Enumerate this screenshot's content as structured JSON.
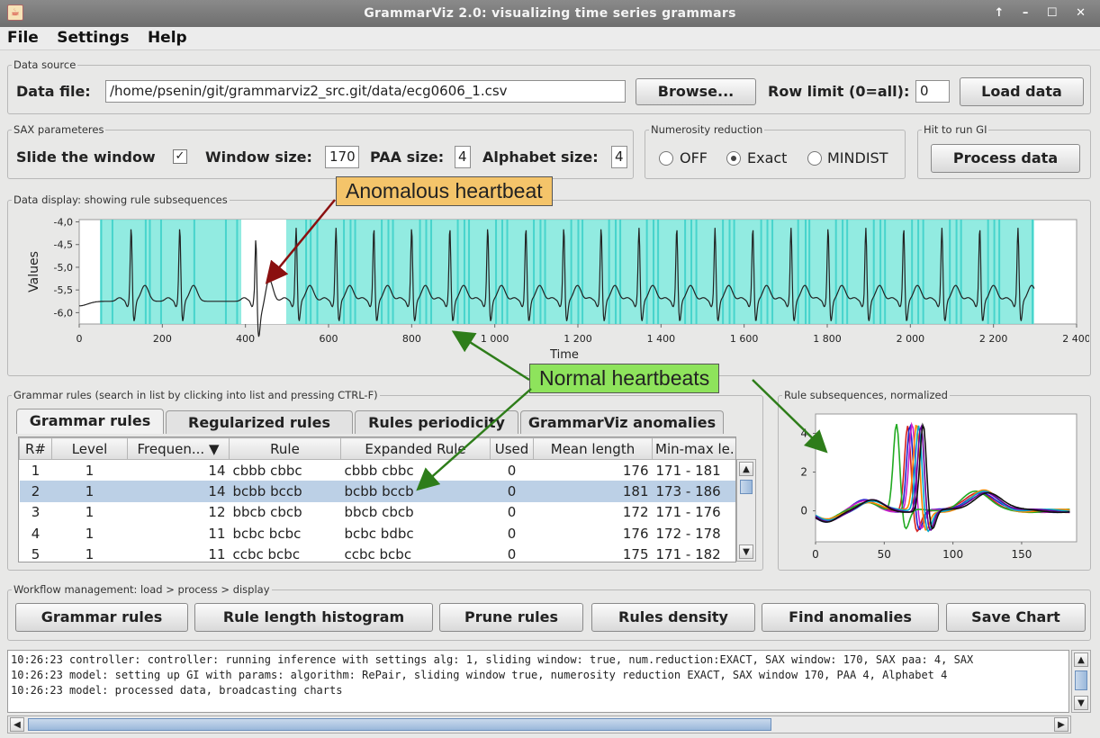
{
  "window": {
    "title": "GrammarViz 2.0: visualizing time series grammars",
    "controls": "↑ – ☐ ✕"
  },
  "menu": [
    "File",
    "Settings",
    "Help"
  ],
  "data_source": {
    "legend": "Data source",
    "data_file_label": "Data file:",
    "data_file_value": "/home/psenin/git/grammarviz2_src.git/data/ecg0606_1.csv",
    "browse_label": "Browse...",
    "row_limit_label": "Row limit (0=all):",
    "row_limit_value": "0",
    "load_label": "Load data"
  },
  "sax": {
    "legend": "SAX parameteres",
    "slide_label": "Slide the window",
    "slide_checked": true,
    "window_label": "Window size:",
    "window_value": "170",
    "paa_label": "PAA size:",
    "paa_value": "4",
    "alphabet_label": "Alphabet size:",
    "alphabet_value": "4"
  },
  "numerosity": {
    "legend": "Numerosity reduction",
    "options": [
      "OFF",
      "Exact",
      "MINDIST"
    ],
    "selected": "Exact"
  },
  "run_gi": {
    "legend": "Hit to run GI",
    "process_label": "Process data"
  },
  "data_display": {
    "legend": "Data display: showing rule subsequences"
  },
  "callouts": {
    "anomalous": "Anomalous heartbeat",
    "normal": "Normal heartbeats"
  },
  "colors": {
    "highlight": "#7fe8dc",
    "highlight_edge": "#35cfc8",
    "anomalous_bg": "#f4c46a",
    "normal_bg": "#8ee35c",
    "arrow_red": "#8b1010",
    "arrow_green": "#2e7d1a"
  },
  "chart_data": [
    {
      "type": "line",
      "title": "",
      "xlabel": "Time",
      "ylabel": "Values",
      "xlim": [
        0,
        2400
      ],
      "ylim": [
        -6.25,
        -3.95
      ],
      "x_ticks": [
        "0",
        "200",
        "400",
        "600",
        "800",
        "1 000",
        "1 200",
        "1 400",
        "1 600",
        "1 800",
        "2 000",
        "2 200",
        "2 400"
      ],
      "y_ticks": [
        "-4,0",
        "-4,5",
        "-5,0",
        "-5,5",
        "-6,0"
      ],
      "signal_length": 2299,
      "baseline": -5.75,
      "beat_peaks_x": [
        125,
        242,
        425,
        522,
        618,
        709,
        800,
        892,
        983,
        1075,
        1166,
        1256,
        1347,
        1438,
        1530,
        1621,
        1713,
        1802,
        1893,
        1984,
        2076,
        2167,
        2259
      ],
      "r_peak_value": -4.1,
      "anomalous_beat_x": 415,
      "highlight_span": [
        50,
        2298
      ],
      "unhighlighted_span": [
        390,
        498
      ]
    },
    {
      "type": "line",
      "title": "",
      "xlim": [
        0,
        190
      ],
      "ylim": [
        -1.6,
        5
      ],
      "x_ticks": [
        "0",
        "50",
        "100",
        "150"
      ],
      "y_ticks": [
        "4",
        "2",
        "0"
      ],
      "series_colors": [
        "#d42020",
        "#2222cc",
        "#cc22cc",
        "#22aa22",
        "#ff8800",
        "#00aacc",
        "#660099",
        "#111111"
      ]
    }
  ],
  "grammar": {
    "legend": "Grammar rules (search in list by clicking into list and pressing CTRL-F)",
    "tabs": [
      "Grammar rules",
      "Regularized rules",
      "Rules periodicity",
      "GrammarViz anomalies"
    ],
    "columns": [
      "R#",
      "Level",
      "Frequen... ▼",
      "Rule",
      "Expanded Rule",
      "Used",
      "Mean length",
      "Min-max le..."
    ],
    "rows": [
      [
        "1",
        "1",
        "14",
        "cbbb cbbc",
        "cbbb cbbc",
        "0",
        "176",
        "171 - 181"
      ],
      [
        "2",
        "1",
        "14",
        "bcbb bccb",
        "bcbb bccb",
        "0",
        "181",
        "173 - 186"
      ],
      [
        "3",
        "1",
        "12",
        "bbcb cbcb",
        "bbcb cbcb",
        "0",
        "172",
        "171 - 176"
      ],
      [
        "4",
        "1",
        "11",
        "bcbc bcbc",
        "bcbc bdbc",
        "0",
        "176",
        "172 - 178"
      ],
      [
        "5",
        "1",
        "11",
        "ccbc bcbc",
        "ccbc bcbc",
        "0",
        "175",
        "171 - 182"
      ]
    ],
    "selected_row": 1
  },
  "rule_subseq": {
    "legend": "Rule subsequences, normalized"
  },
  "workflow": {
    "legend": "Workflow management: load > process > display",
    "buttons": [
      "Grammar rules",
      "Rule length histogram",
      "Prune rules",
      "Rules density",
      "Find anomalies",
      "Save Chart"
    ]
  },
  "log_lines": [
    "10:26:23 controller: controller: running inference with settings alg: 1, sliding window: true, num.reduction:EXACT, SAX window: 170, SAX paa: 4, SAX",
    "10:26:23 model: setting up GI with params: algorithm: RePair, sliding window true, numerosity reduction EXACT, SAX window 170, PAA 4, Alphabet 4",
    "10:26:23 model: processed data, broadcasting charts"
  ]
}
